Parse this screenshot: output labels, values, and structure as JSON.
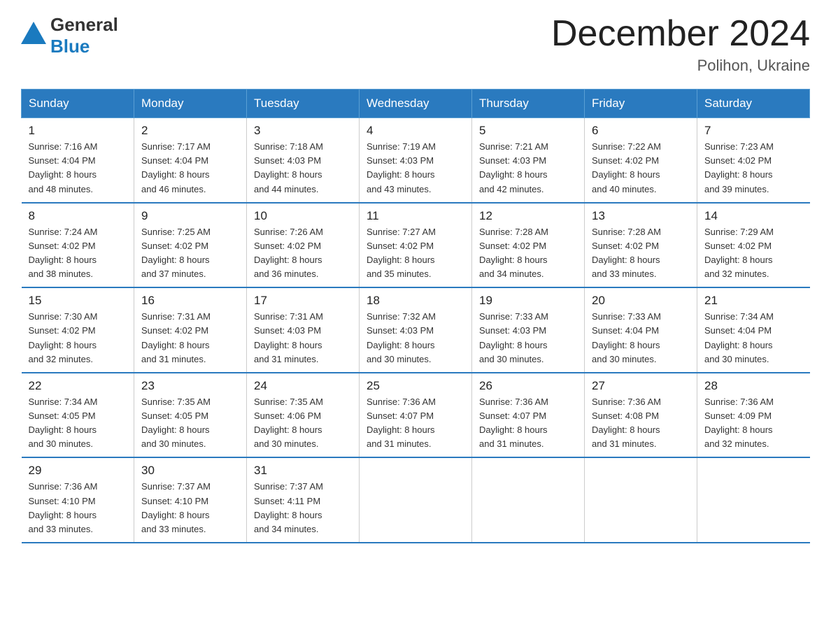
{
  "header": {
    "logo_line1": "General",
    "logo_line2": "Blue",
    "month_title": "December 2024",
    "location": "Polihon, Ukraine"
  },
  "days_of_week": [
    "Sunday",
    "Monday",
    "Tuesday",
    "Wednesday",
    "Thursday",
    "Friday",
    "Saturday"
  ],
  "weeks": [
    [
      {
        "day": "1",
        "sunrise": "7:16 AM",
        "sunset": "4:04 PM",
        "daylight": "8 hours and 48 minutes."
      },
      {
        "day": "2",
        "sunrise": "7:17 AM",
        "sunset": "4:04 PM",
        "daylight": "8 hours and 46 minutes."
      },
      {
        "day": "3",
        "sunrise": "7:18 AM",
        "sunset": "4:03 PM",
        "daylight": "8 hours and 44 minutes."
      },
      {
        "day": "4",
        "sunrise": "7:19 AM",
        "sunset": "4:03 PM",
        "daylight": "8 hours and 43 minutes."
      },
      {
        "day": "5",
        "sunrise": "7:21 AM",
        "sunset": "4:03 PM",
        "daylight": "8 hours and 42 minutes."
      },
      {
        "day": "6",
        "sunrise": "7:22 AM",
        "sunset": "4:02 PM",
        "daylight": "8 hours and 40 minutes."
      },
      {
        "day": "7",
        "sunrise": "7:23 AM",
        "sunset": "4:02 PM",
        "daylight": "8 hours and 39 minutes."
      }
    ],
    [
      {
        "day": "8",
        "sunrise": "7:24 AM",
        "sunset": "4:02 PM",
        "daylight": "8 hours and 38 minutes."
      },
      {
        "day": "9",
        "sunrise": "7:25 AM",
        "sunset": "4:02 PM",
        "daylight": "8 hours and 37 minutes."
      },
      {
        "day": "10",
        "sunrise": "7:26 AM",
        "sunset": "4:02 PM",
        "daylight": "8 hours and 36 minutes."
      },
      {
        "day": "11",
        "sunrise": "7:27 AM",
        "sunset": "4:02 PM",
        "daylight": "8 hours and 35 minutes."
      },
      {
        "day": "12",
        "sunrise": "7:28 AM",
        "sunset": "4:02 PM",
        "daylight": "8 hours and 34 minutes."
      },
      {
        "day": "13",
        "sunrise": "7:28 AM",
        "sunset": "4:02 PM",
        "daylight": "8 hours and 33 minutes."
      },
      {
        "day": "14",
        "sunrise": "7:29 AM",
        "sunset": "4:02 PM",
        "daylight": "8 hours and 32 minutes."
      }
    ],
    [
      {
        "day": "15",
        "sunrise": "7:30 AM",
        "sunset": "4:02 PM",
        "daylight": "8 hours and 32 minutes."
      },
      {
        "day": "16",
        "sunrise": "7:31 AM",
        "sunset": "4:02 PM",
        "daylight": "8 hours and 31 minutes."
      },
      {
        "day": "17",
        "sunrise": "7:31 AM",
        "sunset": "4:03 PM",
        "daylight": "8 hours and 31 minutes."
      },
      {
        "day": "18",
        "sunrise": "7:32 AM",
        "sunset": "4:03 PM",
        "daylight": "8 hours and 30 minutes."
      },
      {
        "day": "19",
        "sunrise": "7:33 AM",
        "sunset": "4:03 PM",
        "daylight": "8 hours and 30 minutes."
      },
      {
        "day": "20",
        "sunrise": "7:33 AM",
        "sunset": "4:04 PM",
        "daylight": "8 hours and 30 minutes."
      },
      {
        "day": "21",
        "sunrise": "7:34 AM",
        "sunset": "4:04 PM",
        "daylight": "8 hours and 30 minutes."
      }
    ],
    [
      {
        "day": "22",
        "sunrise": "7:34 AM",
        "sunset": "4:05 PM",
        "daylight": "8 hours and 30 minutes."
      },
      {
        "day": "23",
        "sunrise": "7:35 AM",
        "sunset": "4:05 PM",
        "daylight": "8 hours and 30 minutes."
      },
      {
        "day": "24",
        "sunrise": "7:35 AM",
        "sunset": "4:06 PM",
        "daylight": "8 hours and 30 minutes."
      },
      {
        "day": "25",
        "sunrise": "7:36 AM",
        "sunset": "4:07 PM",
        "daylight": "8 hours and 31 minutes."
      },
      {
        "day": "26",
        "sunrise": "7:36 AM",
        "sunset": "4:07 PM",
        "daylight": "8 hours and 31 minutes."
      },
      {
        "day": "27",
        "sunrise": "7:36 AM",
        "sunset": "4:08 PM",
        "daylight": "8 hours and 31 minutes."
      },
      {
        "day": "28",
        "sunrise": "7:36 AM",
        "sunset": "4:09 PM",
        "daylight": "8 hours and 32 minutes."
      }
    ],
    [
      {
        "day": "29",
        "sunrise": "7:36 AM",
        "sunset": "4:10 PM",
        "daylight": "8 hours and 33 minutes."
      },
      {
        "day": "30",
        "sunrise": "7:37 AM",
        "sunset": "4:10 PM",
        "daylight": "8 hours and 33 minutes."
      },
      {
        "day": "31",
        "sunrise": "7:37 AM",
        "sunset": "4:11 PM",
        "daylight": "8 hours and 34 minutes."
      },
      null,
      null,
      null,
      null
    ]
  ],
  "labels": {
    "sunrise": "Sunrise:",
    "sunset": "Sunset:",
    "daylight": "Daylight:"
  },
  "accent_color": "#2a7abf"
}
